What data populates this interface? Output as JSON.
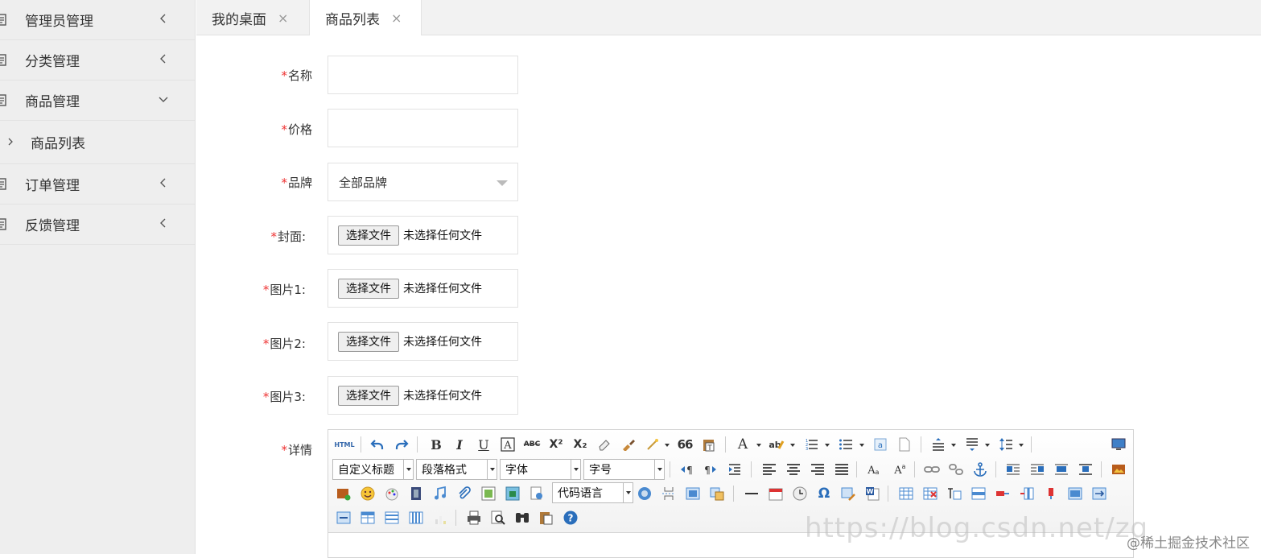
{
  "sidebar": {
    "items": [
      {
        "label": "管理员管理",
        "expanded": false
      },
      {
        "label": "分类管理",
        "expanded": false
      },
      {
        "label": "商品管理",
        "expanded": true
      },
      {
        "label": "订单管理",
        "expanded": false
      },
      {
        "label": "反馈管理",
        "expanded": false
      }
    ],
    "sub_items": [
      {
        "label": "商品列表"
      }
    ]
  },
  "tabs": [
    {
      "label": "我的桌面",
      "close": "×"
    },
    {
      "label": "商品列表",
      "close": "×",
      "active": true
    }
  ],
  "form": {
    "required_mark": "*",
    "name_label": "名称",
    "price_label": "价格",
    "brand_label": "品牌",
    "brand_value": "全部品牌",
    "cover_label": "封面:",
    "img1_label": "图片1:",
    "img2_label": "图片2:",
    "img3_label": "图片3:",
    "detail_label": "详情",
    "file_button": "选择文件",
    "file_empty": "未选择任何文件"
  },
  "editor": {
    "combos": {
      "custom_title": "自定义标题",
      "paragraph": "段落格式",
      "font_family": "字体",
      "font_size": "字号",
      "code_lang": "代码语言"
    },
    "buttons": {
      "html": "HTML",
      "bold": "B",
      "italic": "I",
      "underline": "U",
      "strike": "ABC",
      "sup": "X²",
      "sub": "X₂",
      "quote": "66",
      "font_color": "A",
      "omega": "Ω",
      "help": "?"
    }
  },
  "watermark": "https://blog.csdn.net/zq",
  "community": "@稀土掘金技术社区",
  "colors": {
    "required": "#ee3333",
    "sidebar_bg": "#eeeeee",
    "tab_bg": "#f2f2f2"
  }
}
